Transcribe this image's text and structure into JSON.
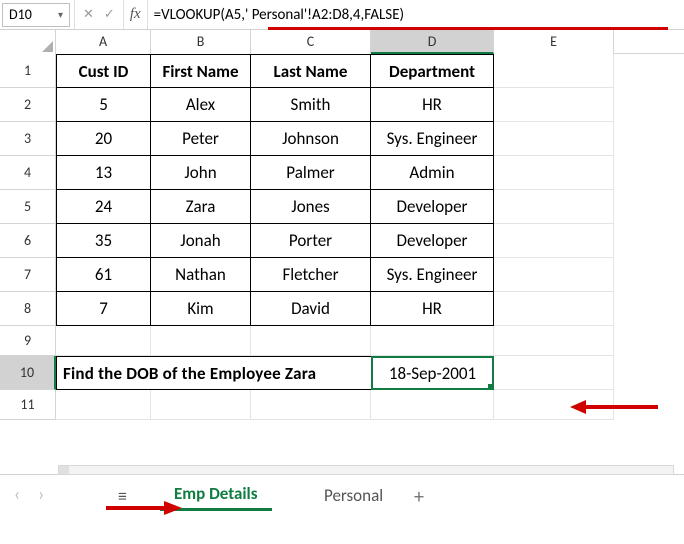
{
  "name_box": "D10",
  "formula": "=VLOOKUP(A5,' Personal'!A2:D8,4,FALSE)",
  "columns": [
    "A",
    "B",
    "C",
    "D",
    "E"
  ],
  "rows": [
    "1",
    "2",
    "3",
    "4",
    "5",
    "6",
    "7",
    "8",
    "9",
    "10",
    "11"
  ],
  "headers": {
    "A": "Cust ID",
    "B": "First Name",
    "C": "Last Name",
    "D": "Department"
  },
  "data": [
    {
      "A": "5",
      "B": "Alex",
      "C": "Smith",
      "D": "HR"
    },
    {
      "A": "20",
      "B": "Peter",
      "C": "Johnson",
      "D": "Sys. Engineer"
    },
    {
      "A": "13",
      "B": "John",
      "C": "Palmer",
      "D": "Admin"
    },
    {
      "A": "24",
      "B": "Zara",
      "C": "Jones",
      "D": "Developer"
    },
    {
      "A": "35",
      "B": "Jonah",
      "C": "Porter",
      "D": "Developer"
    },
    {
      "A": "61",
      "B": "Nathan",
      "C": "Fletcher",
      "D": "Sys. Engineer"
    },
    {
      "A": "7",
      "B": "Kim",
      "C": "David",
      "D": "HR"
    }
  ],
  "task_text": "Find the DOB of the Employee Zara",
  "result": "18-Sep-2001",
  "tabs": {
    "active": "Emp Details",
    "other": "Personal"
  },
  "active_col": "D",
  "active_row": "10"
}
